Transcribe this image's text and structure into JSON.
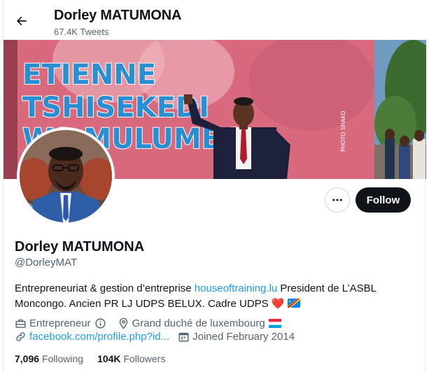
{
  "header": {
    "name": "Dorley MATUMONA",
    "tweet_count": "67.4K Tweets"
  },
  "banner": {
    "sign_line1": "ETIENNE",
    "sign_line2": "TSHISEKEDI",
    "sign_line3": "WA MULUMBA",
    "photo_credit": "PHOTO SHAKO"
  },
  "profile": {
    "name": "Dorley MATUMONA",
    "handle": "@DorleyMAT",
    "bio_part1": "Entrepreneuriat & gestion d’entreprise ",
    "bio_link": "houseoftraining.lu",
    "bio_part2": " President de L’ASBL Moncongo. Ancien PR LJ UDPS BELUX. Cadre UDPS ",
    "bio_emoji": "❤️",
    "category": "Entrepreneur",
    "location": "Grand duché de luxembourg",
    "website": "facebook.com/profile.php?id...",
    "joined": "Joined February 2014"
  },
  "stats": {
    "following_count": "7,096",
    "following_label": "Following",
    "followers_count": "104K",
    "followers_label": "Followers"
  },
  "buttons": {
    "follow_label": "Follow"
  },
  "colors": {
    "link": "#1d9bf0",
    "secondary_text": "#536471",
    "follow_bg": "#0f1419"
  }
}
